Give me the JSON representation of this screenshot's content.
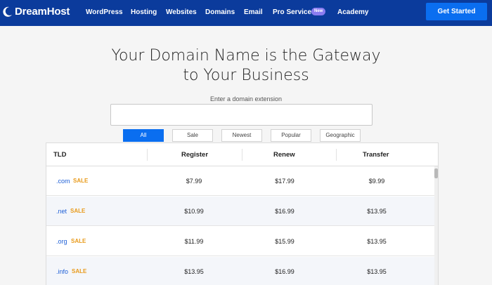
{
  "nav": {
    "brand": "DreamHost",
    "items": [
      "WordPress",
      "Hosting",
      "Websites",
      "Domains",
      "Email",
      "Pro Services",
      "Academy"
    ],
    "badge": "New",
    "cta": "Get Started"
  },
  "hero": {
    "title_line1": "Your Domain Name is the Gateway",
    "title_line2": "to Your Business",
    "input_label": "Enter a domain extension",
    "input_value": ""
  },
  "filters": {
    "tabs": [
      "All",
      "Sale",
      "Newest",
      "Popular",
      "Geographic"
    ],
    "active": "All"
  },
  "table": {
    "headers": [
      "TLD",
      "Register",
      "Renew",
      "Transfer"
    ],
    "rows": [
      {
        "tld": ".com",
        "tag": "SALE",
        "register": "$7.99",
        "renew": "$17.99",
        "transfer": "$9.99"
      },
      {
        "tld": ".net",
        "tag": "SALE",
        "register": "$10.99",
        "renew": "$16.99",
        "transfer": "$13.95"
      },
      {
        "tld": ".org",
        "tag": "SALE",
        "register": "$11.99",
        "renew": "$15.99",
        "transfer": "$13.95"
      },
      {
        "tld": ".info",
        "tag": "SALE",
        "register": "$13.95",
        "renew": "$16.99",
        "transfer": "$13.95"
      }
    ]
  },
  "colors": {
    "nav_bg": "#0b3b9c",
    "accent": "#0a6ef0",
    "sale": "#e89a1a",
    "tld_link": "#1e5fd6",
    "badge": "#8a7cf0"
  }
}
